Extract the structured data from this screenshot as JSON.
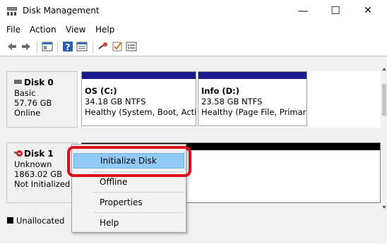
{
  "window": {
    "title": "Disk Management",
    "minimize": "—",
    "maximize": "☐",
    "close": "✕"
  },
  "menu": [
    "File",
    "Action",
    "View",
    "Help"
  ],
  "disks": [
    {
      "name": "Disk 0",
      "type": "Basic",
      "size": "57.76 GB",
      "status": "Online",
      "partitions": [
        {
          "name": "OS  (C:)",
          "size": "34.18 GB NTFS",
          "status": "Healthy (System, Boot, Activ"
        },
        {
          "name": "Info  (D:)",
          "size": "23.58 GB NTFS",
          "status": "Healthy (Page File, Primary"
        }
      ]
    },
    {
      "name": "Disk 1",
      "type": "Unknown",
      "size": "1863.02 GB",
      "status": "Not Initialized"
    }
  ],
  "legend": {
    "unallocated": "Unallocated"
  },
  "context_menu": [
    "Initialize Disk",
    "Offline",
    "Properties",
    "Help"
  ],
  "colors": {
    "partition_bar": "#1a1a8c",
    "unallocated": "#000000",
    "highlight_ring": "#e0101a",
    "menu_highlight": "#91c9f7"
  }
}
